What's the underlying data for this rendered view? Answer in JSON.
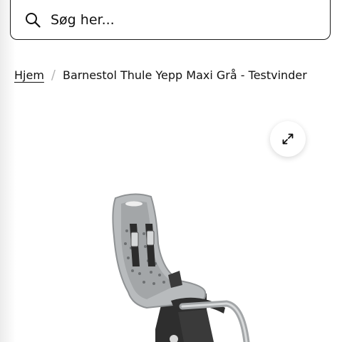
{
  "search": {
    "placeholder": "Søg her..."
  },
  "breadcrumb": {
    "home": "Hjem",
    "separator": "/",
    "current": "Barnestol Thule Yepp Maxi Grå - Testvinder"
  },
  "product_image": {
    "icon": "expand-icon"
  },
  "colors": {
    "seat": "#a9acae",
    "frame": "#2e2e2e",
    "border": "#1a1a1a"
  }
}
